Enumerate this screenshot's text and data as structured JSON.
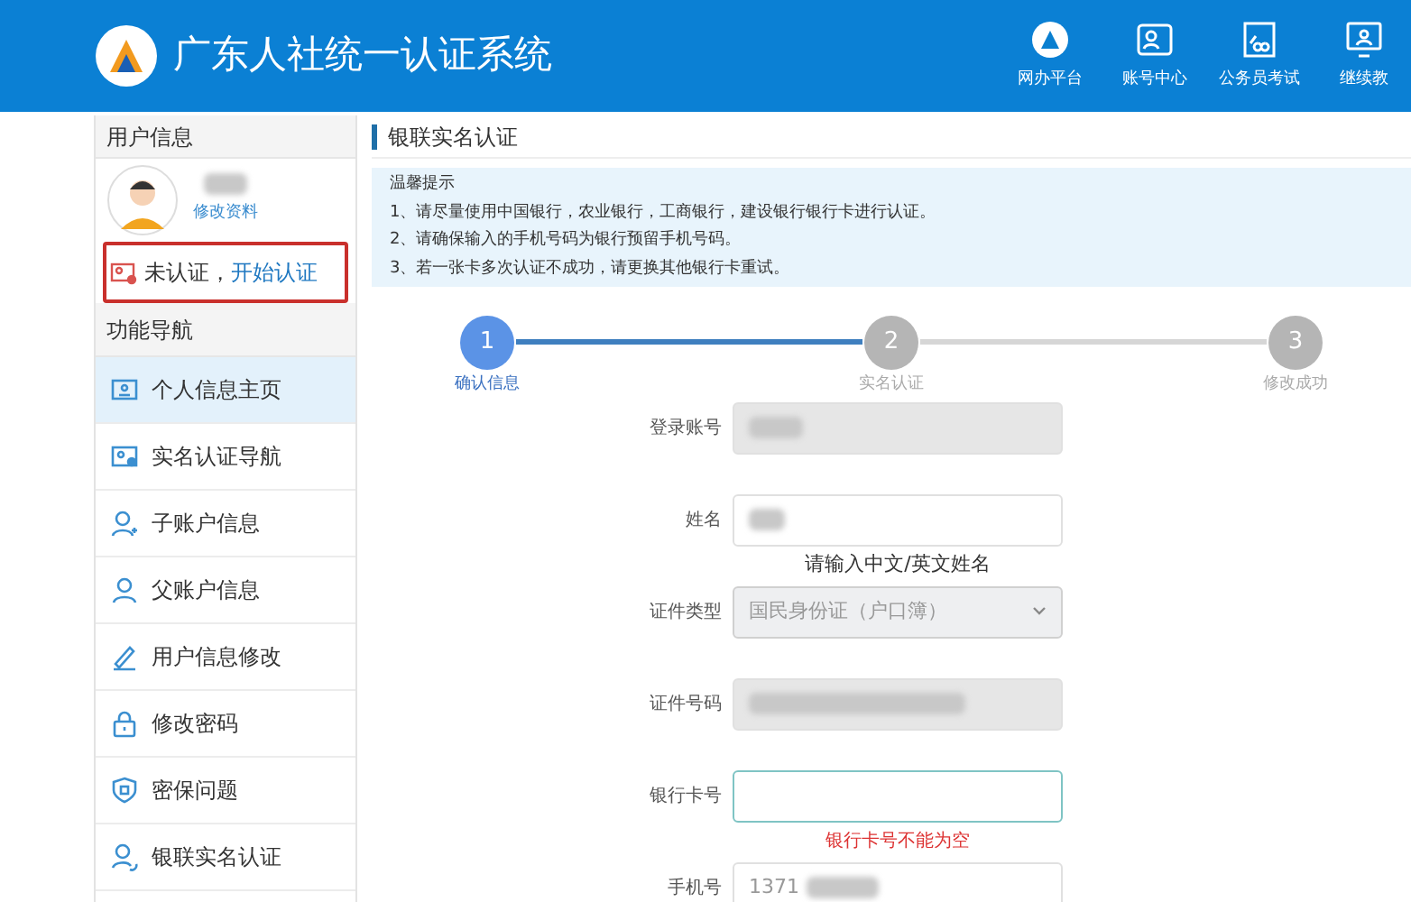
{
  "header": {
    "title": "广东人社统一认证系统",
    "nav": [
      {
        "label": "网办平台",
        "kind": "emblem"
      },
      {
        "label": "账号中心",
        "kind": "id-card"
      },
      {
        "label": "公务员考试",
        "kind": "exam"
      },
      {
        "label": "继续教",
        "kind": "monitor"
      }
    ]
  },
  "sidebar": {
    "user_section": "用户信息",
    "edit_profile": "修改资料",
    "status": {
      "text": "未认证，",
      "link": "开始认证",
      "highlighted": true
    },
    "nav_section": "功能导航",
    "items": [
      {
        "label": "个人信息主页",
        "kind": "home-card",
        "selected": true
      },
      {
        "label": "实名认证导航",
        "kind": "id-card",
        "selected": false
      },
      {
        "label": "子账户信息",
        "kind": "user-plus",
        "selected": false
      },
      {
        "label": "父账户信息",
        "kind": "user",
        "selected": false
      },
      {
        "label": "用户信息修改",
        "kind": "pen",
        "selected": false
      },
      {
        "label": "修改密码",
        "kind": "lock",
        "selected": false
      },
      {
        "label": "密保问题",
        "kind": "shield",
        "selected": false
      },
      {
        "label": "银联实名认证",
        "kind": "user-sync",
        "selected": false
      }
    ]
  },
  "page": {
    "title": "银联实名认证",
    "notice": {
      "heading": "温馨提示",
      "lines": [
        "1、请尽量使用中国银行，农业银行，工商银行，建设银行银行卡进行认证。",
        "2、请确保输入的手机号码为银行预留手机号码。",
        "3、若一张卡多次认证不成功，请更换其他银行卡重试。"
      ]
    },
    "steps": [
      {
        "number": "1",
        "label": "确认信息",
        "selected": true
      },
      {
        "number": "2",
        "label": "实名认证",
        "selected": false
      },
      {
        "number": "3",
        "label": "修改成功",
        "selected": false
      }
    ],
    "fields": [
      {
        "label": "登录账号",
        "kind": "readonly",
        "redacted": true
      },
      {
        "label": "姓名",
        "kind": "text",
        "redacted": true,
        "hint": "请输入中文/英文姓名"
      },
      {
        "label": "证件类型",
        "kind": "select",
        "value": "国民身份证（户口簿）"
      },
      {
        "label": "证件号码",
        "kind": "readonly",
        "redacted": true
      },
      {
        "label": "银行卡号",
        "kind": "text",
        "focused": true,
        "error": "银行卡号不能为空"
      },
      {
        "label": "手机号",
        "kind": "text",
        "value": "1371",
        "redacted": true
      }
    ]
  }
}
